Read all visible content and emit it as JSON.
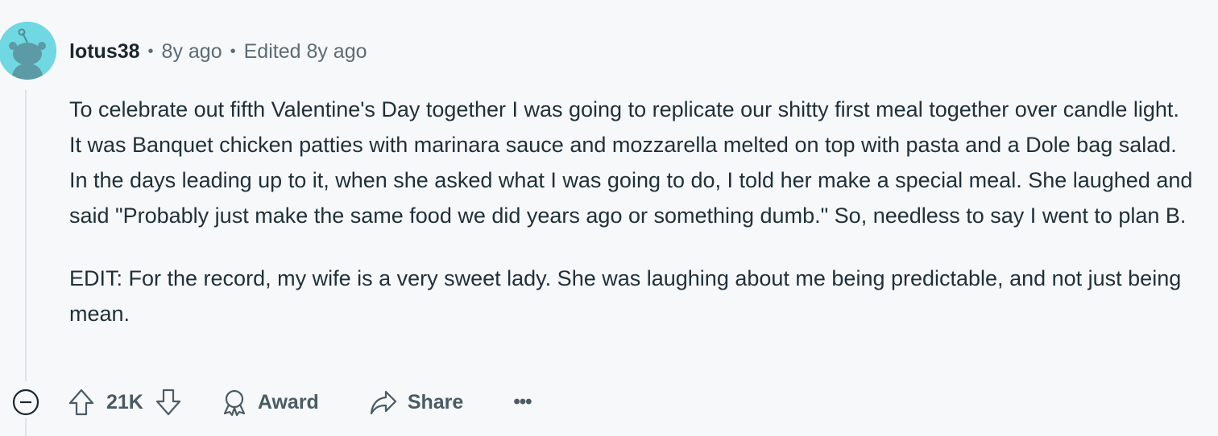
{
  "comment": {
    "author": "lotus38",
    "age": "8y ago",
    "edited": "Edited 8y ago",
    "separator": "•",
    "paragraphs": [
      "To celebrate out fifth Valentine's Day together I was going to replicate our shitty first meal together over candle light. It was Banquet chicken patties with marinara sauce and mozzarella melted on top with pasta and a Dole bag salad. In the days leading up to it, when she asked what I was going to do, I told her make a special meal. She laughed and said \"Probably just make the same food we did years ago or something dumb.\" So, needless to say I went to plan B.",
      "EDIT: For the record, my wife is a very sweet lady. She was laughing about me being predictable, and not just being mean."
    ]
  },
  "actions": {
    "upvote_icon": "upvote-arrow-icon",
    "vote_count": "21K",
    "downvote_icon": "downvote-arrow-icon",
    "award_label": "Award",
    "award_icon": "award-ribbon-icon",
    "share_label": "Share",
    "share_icon": "share-arrow-icon",
    "more_label": "•••",
    "collapse_icon": "collapse-minus-icon"
  },
  "colors": {
    "background": "#f7f8fa",
    "avatar_bg": "#6fd8e3",
    "text": "#1f3038",
    "meta": "#5c6c74"
  }
}
